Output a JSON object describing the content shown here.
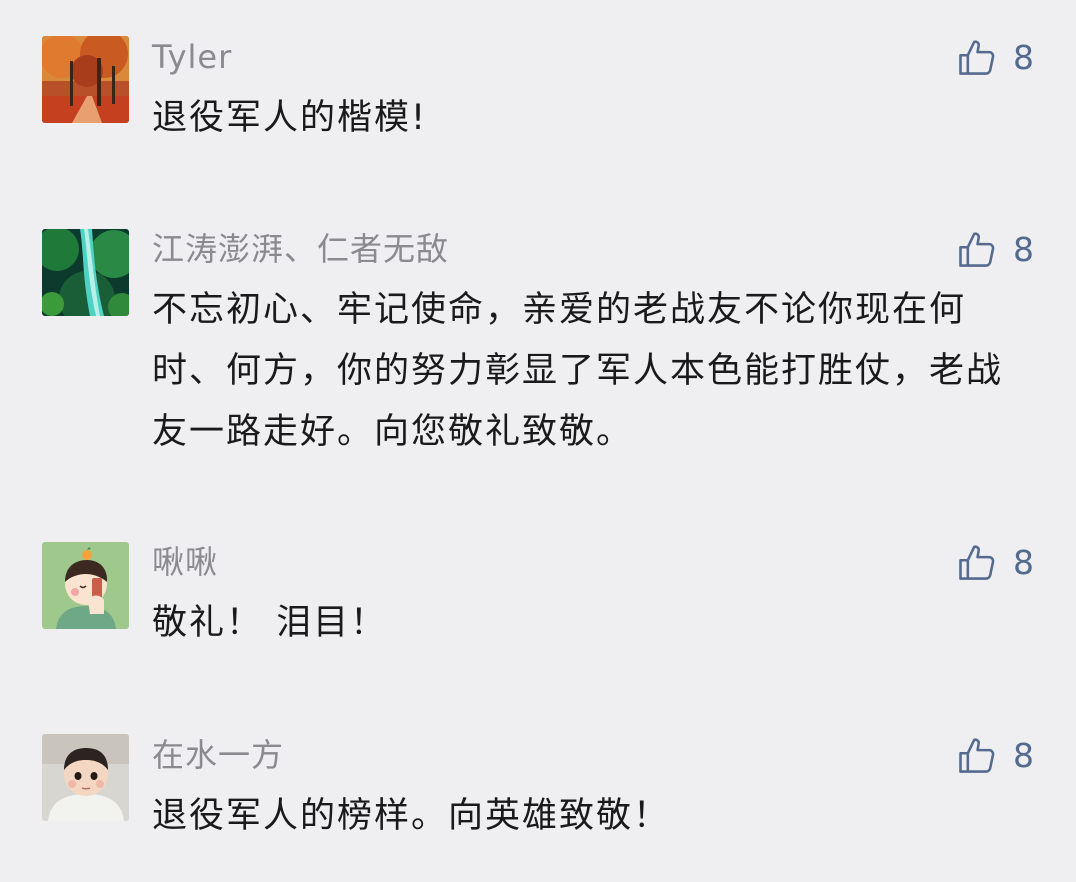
{
  "comments": [
    {
      "avatar": "autumn-trees-avatar",
      "nickname": "Tyler",
      "content": "退役军人的楷模!",
      "likes": "8"
    },
    {
      "avatar": "green-waterfall-avatar",
      "nickname": "江涛澎湃、仁者无敌",
      "content": "不忘初心、牢记使命，亲爱的老战友不论你现在何时、何方，你的努力彰显了军人本色能打胜仗，老战友一路走好。向您敬礼致敬。",
      "likes": "8"
    },
    {
      "avatar": "cartoon-person-avatar",
      "nickname": "啾啾",
      "content": "敬礼！ 泪目！",
      "likes": "8"
    },
    {
      "avatar": "baby-photo-avatar",
      "nickname": "在水一方",
      "content": "退役军人的榜样。向英雄致敬！",
      "likes": "8"
    }
  ],
  "icons": {
    "like": "thumbs-up-icon"
  },
  "colors": {
    "background": "#efeff1",
    "nickname": "#8a8a8f",
    "content": "#1a1a1a",
    "like_accent": "#556a8f"
  }
}
